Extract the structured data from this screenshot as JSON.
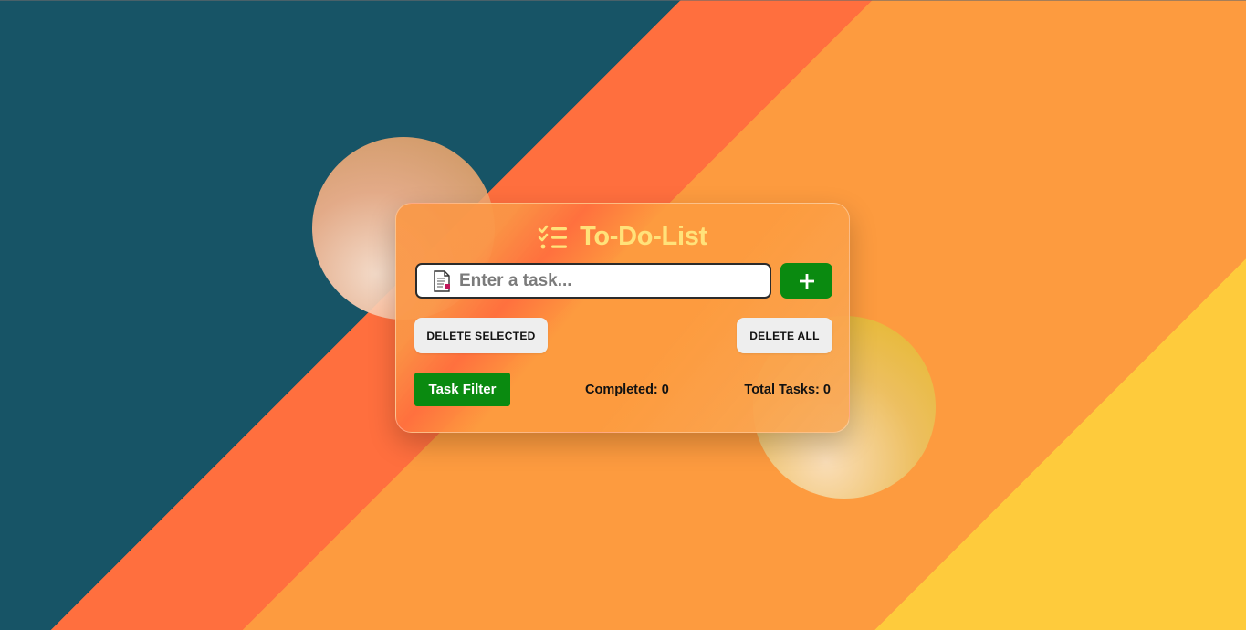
{
  "app": {
    "title": "To-Do-List"
  },
  "input": {
    "placeholder": "Enter a task...",
    "value": ""
  },
  "buttons": {
    "add_label": "+",
    "delete_selected_label": "DELETE SELECTED",
    "delete_all_label": "DELETE ALL",
    "task_filter_label": "Task Filter"
  },
  "stats": {
    "completed_label": "Completed:",
    "completed_count": "0",
    "total_label": "Total Tasks:",
    "total_count": "0"
  },
  "icons": {
    "title": "checklist-icon",
    "input": "document-icon",
    "add": "plus-icon"
  },
  "colors": {
    "accent_green": "#0a8a10",
    "title_yellow": "#ffe27a",
    "background_teal": "#175466",
    "background_orange": "#fd9b3f",
    "background_red_orange": "#ff6f3e",
    "background_yellow": "#fecb3c"
  }
}
